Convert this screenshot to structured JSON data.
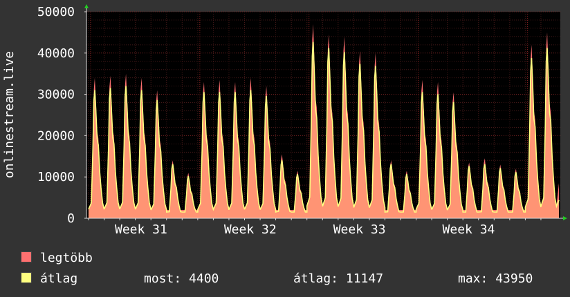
{
  "chart_data": {
    "type": "area",
    "ylabel": "onlinestream.live",
    "ylim": [
      0,
      50000
    ],
    "yticks": [
      0,
      10000,
      20000,
      30000,
      40000,
      50000
    ],
    "ytick_labels": [
      "0",
      "10000",
      "20000",
      "30000",
      "40000",
      "50000"
    ],
    "week_labels": [
      "Week 31",
      "Week 32",
      "Week 33",
      "Week 34"
    ],
    "grid": true,
    "colors": {
      "background": "#000000",
      "grid": "#550000",
      "legtobb": "#ff7070",
      "atlag": "#ffff80",
      "axis": "#dddddd",
      "text": "#ffffff",
      "frame": "#333333"
    },
    "x_unit": "day",
    "daily_peaks": [
      {
        "day": 1,
        "max": 34000,
        "avg": 32000
      },
      {
        "day": 2,
        "max": 34500,
        "avg": 32500
      },
      {
        "day": 3,
        "max": 35000,
        "avg": 33000
      },
      {
        "day": 4,
        "max": 34000,
        "avg": 32000
      },
      {
        "day": 5,
        "max": 31000,
        "avg": 29500
      },
      {
        "day": 6,
        "max": 14000,
        "avg": 13500
      },
      {
        "day": 7,
        "max": 11000,
        "avg": 10500
      },
      {
        "day": 8,
        "max": 33000,
        "avg": 31500
      },
      {
        "day": 9,
        "max": 33500,
        "avg": 31500
      },
      {
        "day": 10,
        "max": 33000,
        "avg": 31500
      },
      {
        "day": 11,
        "max": 34000,
        "avg": 32000
      },
      {
        "day": 12,
        "max": 32000,
        "avg": 30500
      },
      {
        "day": 13,
        "max": 15500,
        "avg": 14500
      },
      {
        "day": 14,
        "max": 11500,
        "avg": 11000
      },
      {
        "day": 15,
        "max": 47000,
        "avg": 44000
      },
      {
        "day": 16,
        "max": 44500,
        "avg": 42500
      },
      {
        "day": 17,
        "max": 44000,
        "avg": 41500
      },
      {
        "day": 18,
        "max": 40500,
        "avg": 38500
      },
      {
        "day": 19,
        "max": 40000,
        "avg": 38000
      },
      {
        "day": 20,
        "max": 14000,
        "avg": 13500
      },
      {
        "day": 21,
        "max": 11500,
        "avg": 11000
      },
      {
        "day": 22,
        "max": 33500,
        "avg": 31500
      },
      {
        "day": 23,
        "max": 33000,
        "avg": 31000
      },
      {
        "day": 24,
        "max": 30500,
        "avg": 29000
      },
      {
        "day": 25,
        "max": 13500,
        "avg": 13000
      },
      {
        "day": 26,
        "max": 14500,
        "avg": 13500
      },
      {
        "day": 27,
        "max": 13000,
        "avg": 12500
      },
      {
        "day": 28,
        "max": 12000,
        "avg": 11500
      },
      {
        "day": 29,
        "max": 42000,
        "avg": 40000
      },
      {
        "day": 30,
        "max": 45000,
        "avg": 42500
      }
    ],
    "series": [
      {
        "name": "legtöbb",
        "color": "#ff7070",
        "values": [
          34000,
          34500,
          35000,
          34000,
          31000,
          14000,
          11000,
          33000,
          33500,
          33000,
          34000,
          32000,
          15500,
          11500,
          47000,
          44500,
          44000,
          40500,
          40000,
          14000,
          11500,
          33500,
          33000,
          30500,
          13500,
          14500,
          13000,
          12000,
          42000,
          45000
        ]
      },
      {
        "name": "átlag",
        "color": "#ffff80",
        "values": [
          32000,
          32500,
          33000,
          32000,
          29500,
          13500,
          10500,
          31500,
          31500,
          31500,
          32000,
          30500,
          14500,
          11000,
          44000,
          42500,
          41500,
          38500,
          38000,
          13500,
          11000,
          31500,
          31000,
          29000,
          13000,
          13500,
          12500,
          11500,
          40000,
          42500
        ]
      }
    ]
  },
  "legend": {
    "max_label": "legtöbb",
    "avg_label": "átlag",
    "stats": {
      "most_label": "most:",
      "most_value": "4400",
      "atlag_label": "átlag:",
      "atlag_value": "11147",
      "max_label": "max:",
      "max_value": "43950"
    }
  }
}
